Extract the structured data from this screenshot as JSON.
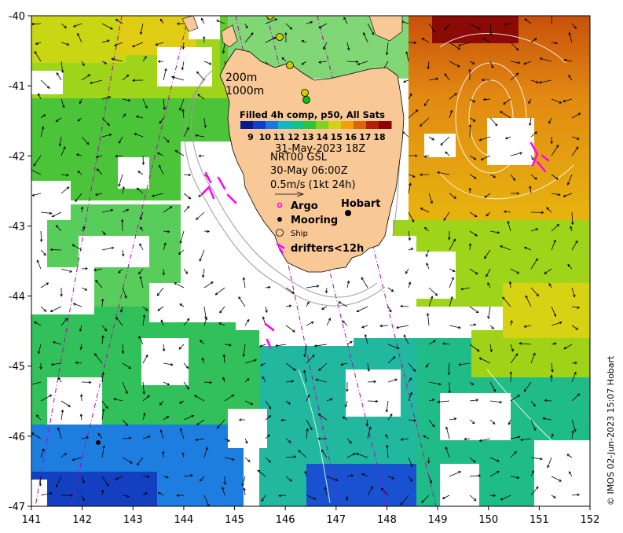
{
  "map": {
    "x_ticks": [
      "141",
      "142",
      "143",
      "144",
      "145",
      "146",
      "147",
      "148",
      "149",
      "150",
      "151",
      "152"
    ],
    "y_ticks": [
      "-40",
      "-41",
      "-42",
      "-43",
      "-44",
      "-45",
      "-46",
      "-47"
    ],
    "lon_range": [
      141,
      152
    ],
    "lat_range": [
      -47,
      -40
    ],
    "isobaths": [
      "200m",
      "1000m"
    ],
    "colorbar": {
      "title": "Filled 4h comp, p50, All Sats",
      "labels": [
        "9",
        "10",
        "11",
        "12",
        "13",
        "14",
        "15",
        "16",
        "17",
        "18"
      ],
      "colors": [
        "#0a1a8c",
        "#1040c8",
        "#1a78e0",
        "#14b4c8",
        "#10c48a",
        "#2cc43c",
        "#80d21e",
        "#d4d214",
        "#f0a00a",
        "#dc640a",
        "#b41e0a",
        "#8c0000"
      ]
    },
    "info": {
      "date": "31-May-2023 18Z",
      "product": "NRT00 GSL",
      "time": "30-May 06:00Z",
      "scale": "0.5m/s (1kt 24h)"
    },
    "city": "Hobart",
    "legend": {
      "argo": "Argo",
      "mooring": "Mooring",
      "ship": "Ship",
      "drifters": "drifters<12h"
    },
    "credit": "© IMOS 02-Jun-2023 15:07 Hobart",
    "colors": {
      "land": "#f9c897",
      "drifter": "#ff00ff",
      "orbit": "#b400b4",
      "ship_track": "#cccc00"
    }
  }
}
